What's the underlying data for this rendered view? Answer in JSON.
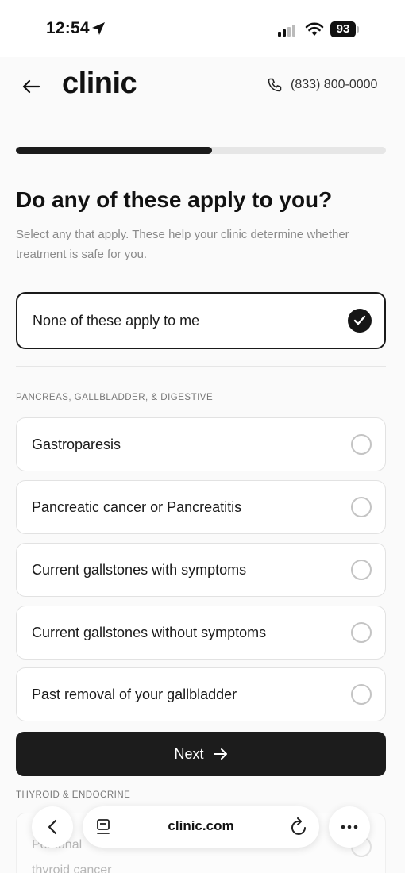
{
  "status_bar": {
    "time": "12:54",
    "battery": "93"
  },
  "header": {
    "brand": "clinic",
    "phone": "(833) 800-0000"
  },
  "progress": {
    "fraction": 0.53
  },
  "question": {
    "title": "Do any of these apply to you?",
    "subtitle": "Select any that apply. These help your clinic determine whether treatment is safe for you."
  },
  "none_option": {
    "label": "None of these apply to me",
    "selected": true
  },
  "sections": [
    {
      "label": "PANCREAS, GALLBLADDER, & DIGESTIVE",
      "options": [
        {
          "label": "Gastroparesis",
          "selected": false
        },
        {
          "label": "Pancreatic cancer or Pancreatitis",
          "selected": false
        },
        {
          "label": "Current gallstones with symptoms",
          "selected": false
        },
        {
          "label": "Current gallstones without symptoms",
          "selected": false
        },
        {
          "label": "Past removal of your gallbladder",
          "selected": false
        }
      ]
    },
    {
      "label": "THYROID & ENDOCRINE",
      "options": [
        {
          "label": "Personal",
          "label_line2": "thyroid cancer",
          "selected": false
        }
      ]
    }
  ],
  "next_button": {
    "label": "Next"
  },
  "browser": {
    "url": "clinic.com"
  },
  "colors": {
    "primary": "#1c1c1c",
    "border": "#e2e2e2",
    "muted_text": "#8a8a8a",
    "background": "#fafafa"
  }
}
